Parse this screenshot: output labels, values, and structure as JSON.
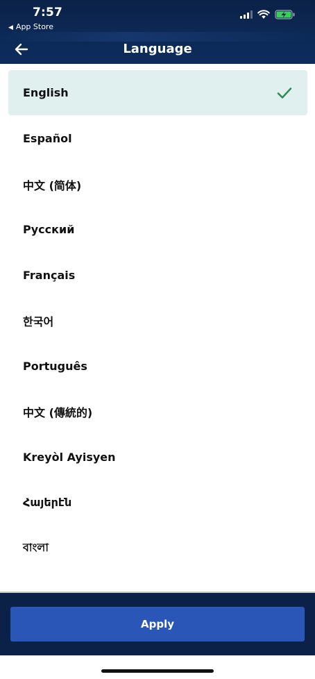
{
  "status_bar": {
    "time": "7:57",
    "back_app_label": "App Store"
  },
  "nav": {
    "title": "Language",
    "back_icon": "arrow-left-icon"
  },
  "languages": [
    {
      "label": "English",
      "selected": true
    },
    {
      "label": "Español",
      "selected": false
    },
    {
      "label": "中文 (简体)",
      "selected": false
    },
    {
      "label": "Русский",
      "selected": false
    },
    {
      "label": "Français",
      "selected": false
    },
    {
      "label": "한국어",
      "selected": false
    },
    {
      "label": "Português",
      "selected": false
    },
    {
      "label": "中文 (傳統的)",
      "selected": false
    },
    {
      "label": "Kreyòl Ayisyen",
      "selected": false
    },
    {
      "label": "Հայերէն",
      "selected": false
    },
    {
      "label": "বাংলা",
      "selected": false
    }
  ],
  "footer": {
    "apply_label": "Apply"
  },
  "colors": {
    "header_bg": "#0b2148",
    "selected_bg": "#dff0ee",
    "check": "#2e8b57",
    "apply_bg": "#2a56b8"
  }
}
